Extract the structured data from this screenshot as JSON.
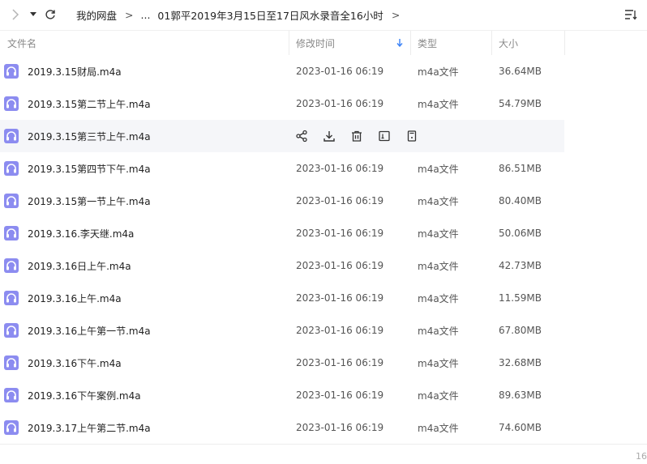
{
  "toolbar": {
    "icons": [
      "forward-arrow-icon",
      "dropdown-caret-icon",
      "refresh-icon",
      "sort-list-icon"
    ]
  },
  "breadcrumb": {
    "root": "我的网盘",
    "ellipsis": "...",
    "current": "01郭平2019年3月15日至17日风水录音全16小时",
    "separator": ">"
  },
  "columns": {
    "name": "文件名",
    "modified": "修改时间",
    "type": "类型",
    "size": "大小"
  },
  "files": [
    {
      "name": "2019.3.15财局.m4a",
      "date": "2023-01-16 06:19",
      "type": "m4a文件",
      "size": "36.64MB"
    },
    {
      "name": "2019.3.15第二节上午.m4a",
      "date": "2023-01-16 06:19",
      "type": "m4a文件",
      "size": "54.79MB"
    },
    {
      "name": "2019.3.15第三节上午.m4a",
      "date": "",
      "type": "",
      "size": "",
      "hovered": true
    },
    {
      "name": "2019.3.15第四节下午.m4a",
      "date": "2023-01-16 06:19",
      "type": "m4a文件",
      "size": "86.51MB"
    },
    {
      "name": "2019.3.15第一节上午.m4a",
      "date": "2023-01-16 06:19",
      "type": "m4a文件",
      "size": "80.40MB"
    },
    {
      "name": "2019.3.16.李天继.m4a",
      "date": "2023-01-16 06:19",
      "type": "m4a文件",
      "size": "50.06MB"
    },
    {
      "name": "2019.3.16日上午.m4a",
      "date": "2023-01-16 06:19",
      "type": "m4a文件",
      "size": "42.73MB"
    },
    {
      "name": "2019.3.16上午.m4a",
      "date": "2023-01-16 06:19",
      "type": "m4a文件",
      "size": "11.59MB"
    },
    {
      "name": "2019.3.16上午第一节.m4a",
      "date": "2023-01-16 06:19",
      "type": "m4a文件",
      "size": "67.80MB"
    },
    {
      "name": "2019.3.16下午.m4a",
      "date": "2023-01-16 06:19",
      "type": "m4a文件",
      "size": "32.68MB"
    },
    {
      "name": "2019.3.16下午案例.m4a",
      "date": "2023-01-16 06:19",
      "type": "m4a文件",
      "size": "89.63MB"
    },
    {
      "name": "2019.3.17上午第二节.m4a",
      "date": "2023-01-16 06:19",
      "type": "m4a文件",
      "size": "74.60MB"
    }
  ],
  "hover_actions": [
    "share-icon",
    "download-icon",
    "delete-icon",
    "rename-icon",
    "more-icon"
  ],
  "file_icon": "audio-headphones-icon",
  "colors": {
    "file_icon": "#8c8cf0",
    "sort_arrow": "#3b82f6",
    "hover_row": "#f5f6f9"
  },
  "footer": {
    "count": "16"
  }
}
